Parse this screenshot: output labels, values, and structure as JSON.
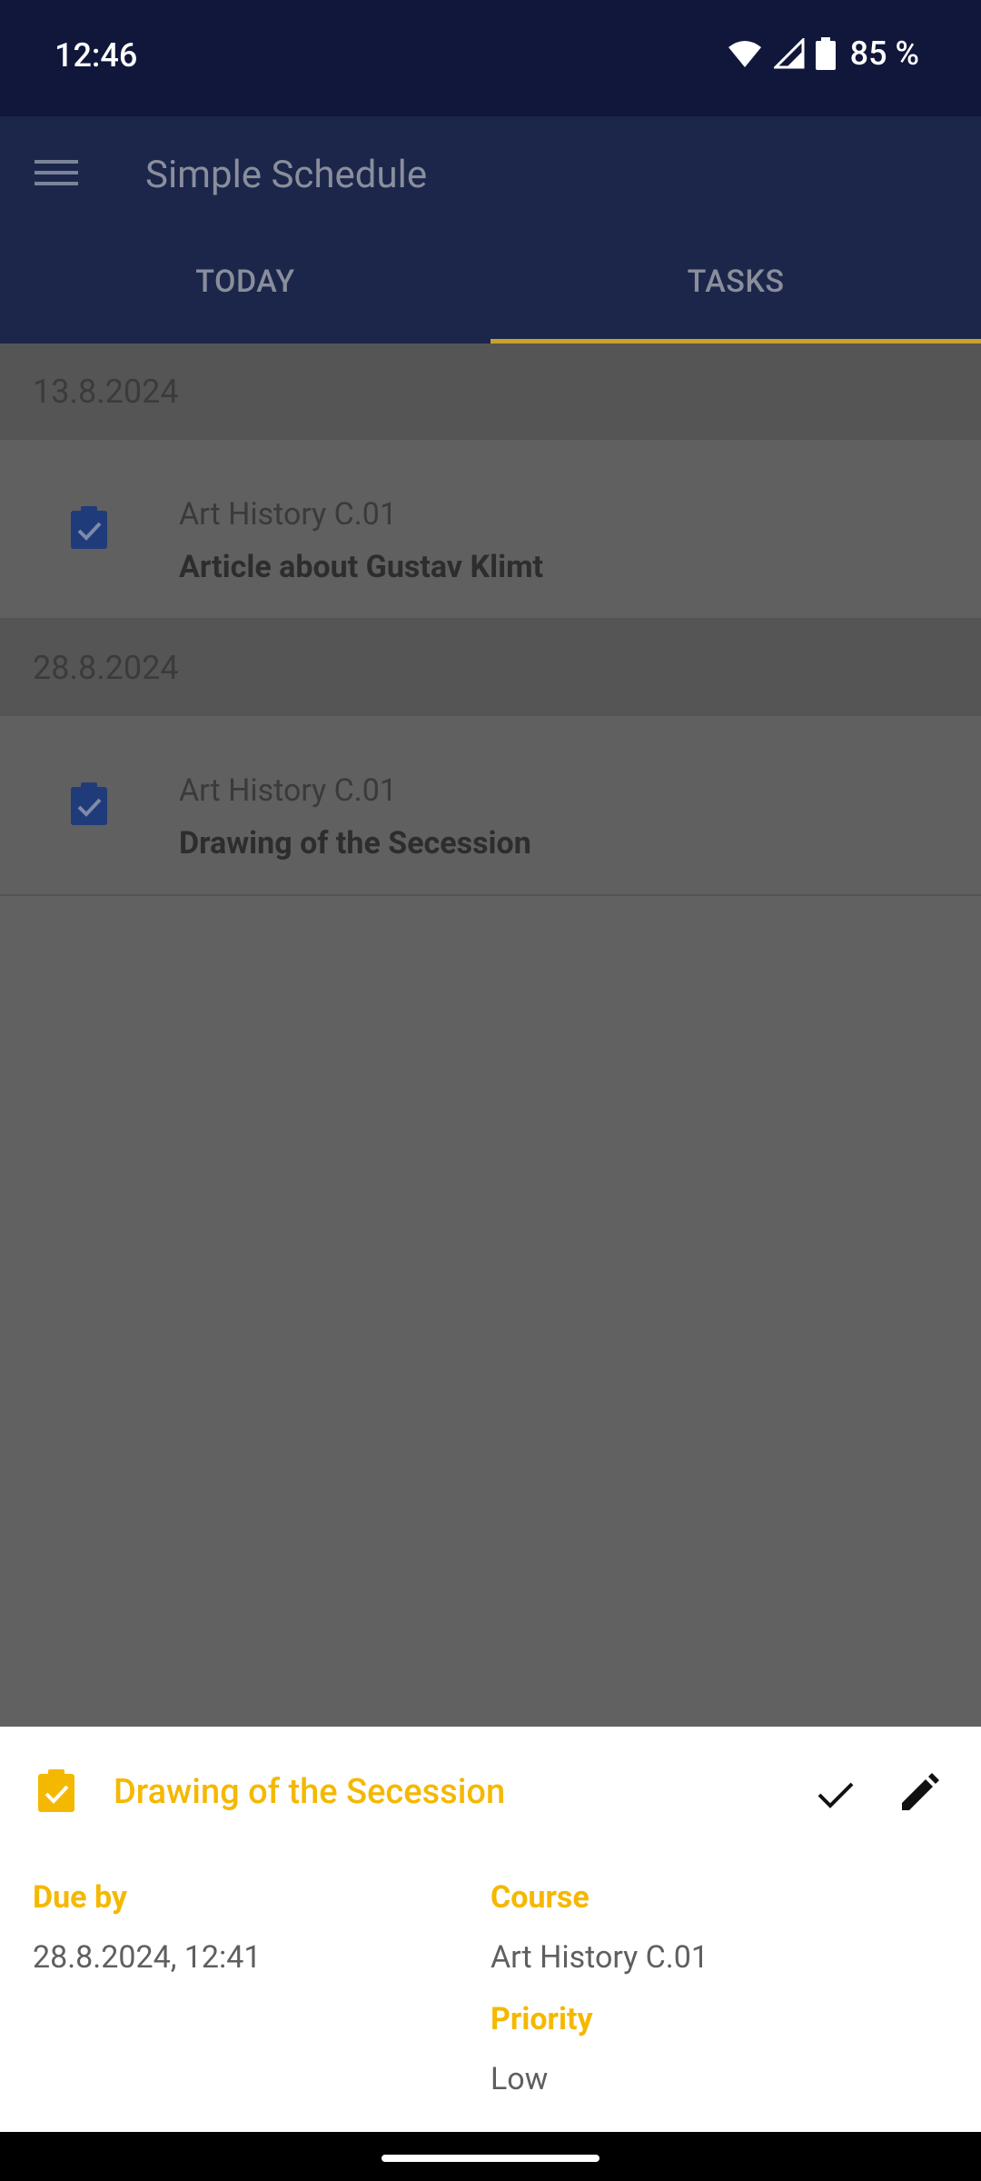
{
  "status_bar": {
    "time": "12:46",
    "battery_pct": "85 %"
  },
  "app_bar": {
    "title": "Simple Schedule"
  },
  "tabs": [
    {
      "label": "TODAY"
    },
    {
      "label": "TASKS"
    }
  ],
  "task_groups": [
    {
      "date": "13.8.2024",
      "tasks": [
        {
          "course": "Art History C.01",
          "name": "Article about Gustav Klimt"
        }
      ]
    },
    {
      "date": "28.8.2024",
      "tasks": [
        {
          "course": "Art History C.01",
          "name": "Drawing of the Secession"
        }
      ]
    }
  ],
  "detail_sheet": {
    "title": "Drawing of the Secession",
    "due_label": "Due by",
    "due_value": "28.8.2024, 12:41",
    "course_label": "Course",
    "course_value": "Art History C.01",
    "priority_label": "Priority",
    "priority_value": "Low"
  },
  "colors": {
    "accent": "#f5b800",
    "app_bar": "#1b264a",
    "status_bar": "#11173a",
    "task_icon": "#1f3b7a"
  }
}
